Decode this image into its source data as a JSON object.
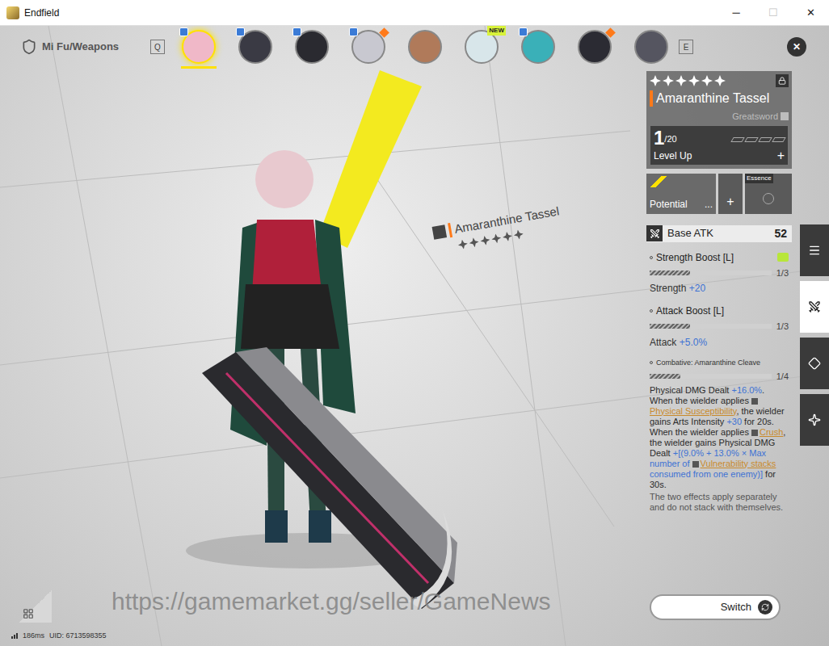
{
  "window": {
    "title": "Endfield",
    "controls": [
      {
        "glyph": "─",
        "disabled": false
      },
      {
        "glyph": "☐",
        "disabled": true
      },
      {
        "glyph": "✕",
        "disabled": false
      }
    ]
  },
  "header": {
    "breadcrumb": "Mi Fu/Weapons",
    "key_prev": "Q",
    "key_next": "E",
    "close": "✕"
  },
  "portraits": [
    {
      "selected": true,
      "badge": true,
      "diamond": false,
      "color": "#f0b8c8"
    },
    {
      "selected": false,
      "badge": true,
      "diamond": false,
      "color": "#3a3a44"
    },
    {
      "selected": false,
      "badge": true,
      "diamond": false,
      "color": "#2a2a30"
    },
    {
      "selected": false,
      "badge": true,
      "diamond": true,
      "color": "#c8c8d0"
    },
    {
      "selected": false,
      "badge": false,
      "diamond": false,
      "color": "#b07a5a"
    },
    {
      "selected": false,
      "badge": false,
      "diamond": false,
      "color": "#d8e6ea",
      "tag": "NEW"
    },
    {
      "selected": false,
      "badge": true,
      "diamond": false,
      "color": "#3ab0b8"
    },
    {
      "selected": false,
      "badge": false,
      "diamond": true,
      "color": "#2b2b33"
    },
    {
      "selected": false,
      "badge": false,
      "diamond": false,
      "color": "#555560"
    }
  ],
  "scene_label": {
    "name": "Amaranthine Tassel",
    "stars": 6
  },
  "weapon": {
    "stars": 6,
    "locked": true,
    "name": "Amaranthine Tassel",
    "type": "Greatsword",
    "level": "1",
    "max_level": "/20",
    "level_label": "Level Up",
    "level_plus": "+",
    "breakthroughs": [
      false,
      false,
      false,
      false
    ],
    "potential_label": "Potential",
    "potential_more": "...",
    "potential_plus": "+",
    "essence_label": "Essence"
  },
  "base_atk": {
    "label": "Base ATK",
    "value": "52"
  },
  "skills": [
    {
      "name": "Strength Boost [L]",
      "upgradable": true,
      "level": 0.333,
      "rank": "1/3",
      "stat": "Strength",
      "value": "+20"
    },
    {
      "name": "Attack Boost [L]",
      "upgradable": false,
      "level": 0.333,
      "rank": "1/3",
      "stat": "Attack",
      "value": "+5.0%"
    }
  ],
  "combative": {
    "name": "Combative: Amaranthine Cleave",
    "level": 0.25,
    "rank": "1/4",
    "description": [
      {
        "kind": "text",
        "text": "Physical DMG Dealt "
      },
      {
        "kind": "value",
        "text": "+16.0%"
      },
      {
        "kind": "text",
        "text": ". When the wielder applies "
      },
      {
        "kind": "term",
        "text": "Physical Susceptibility"
      },
      {
        "kind": "text",
        "text": ", the wielder gains Arts Intensity "
      },
      {
        "kind": "value",
        "text": "+30"
      },
      {
        "kind": "text",
        "text": " for 20s. When the wielder applies "
      },
      {
        "kind": "term",
        "text": "Crush"
      },
      {
        "kind": "text",
        "text": ", the wielder gains Physical DMG Dealt "
      },
      {
        "kind": "value",
        "text": "+[(9.0% + 13.0% × Max number of "
      },
      {
        "kind": "term",
        "text": "Vulnerability stacks"
      },
      {
        "kind": "value",
        "text": " consumed from one enemy)]"
      },
      {
        "kind": "text",
        "text": " for 30s."
      }
    ],
    "note": "The two effects apply separately and do not stack with themselves."
  },
  "side_tabs": [
    {
      "selected": false
    },
    {
      "selected": true
    },
    {
      "selected": false
    },
    {
      "selected": false
    }
  ],
  "footer": {
    "ping": "186ms",
    "uid": "UID: 6713598355",
    "switch": "Switch"
  },
  "watermark": "https://gamemarket.gg/seller/GameNews"
}
